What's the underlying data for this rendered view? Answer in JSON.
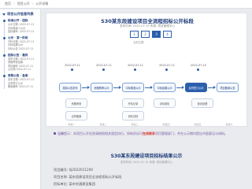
{
  "breadcrumb": [
    "首页",
    "项目公开",
    "公开详情"
  ],
  "sidebar": {
    "heading": "项目公开信息列表",
    "items": [
      {
        "title": "标准公开 · 招标",
        "lines": [
          "公示日期: 2022-07-11",
          "中标候选人公示",
          "招标编号: 2022-07-11"
        ]
      },
      {
        "title": "公示 · 第一阶段",
        "lines": [
          "开标日期: 2022-07-11",
          "评标结果公示",
          "中标公告 2022-07-11"
        ]
      },
      {
        "title": "招标公告 · 最终",
        "lines": [
          "发布日期: 2022-07-11",
          "资格审查结果",
          "项目编号 2022-07-11",
          "公示期 2022-07-11"
        ]
      },
      {
        "title": "采购公告 · 备案",
        "lines": [
          "发布日期: 2022-07-11",
          "合同签订公示",
          "备案编号 2022-07-11"
        ]
      }
    ]
  },
  "main": {
    "title": "S30某东段建设项目全流程招标公开标段",
    "subline": "发布时间: 2022-07-19  来源: 项目管理中心",
    "tabs": [
      "1",
      "2",
      "3",
      "4"
    ],
    "active_tab": 2,
    "jump": "当前位置",
    "dates": [
      "2022-07-11",
      "2022-07-11",
      "2022-07-11",
      "2022-07-11",
      "2022-07-15"
    ],
    "nodes_row1": [
      "招标公告发布",
      "资格预审公示",
      "中标候选公示",
      "中标结果公示",
      "合同签订公示",
      "项目备案公告"
    ],
    "nodes_row2": [
      "资格审查",
      "开标记录",
      "评标报告",
      "投诉处理"
    ],
    "nodes_row3": [
      "合同备案",
      "资料归档"
    ],
    "stages": [
      "标段一",
      "标段二",
      "标段三",
      "标段四",
      "标段五",
      "标段六"
    ]
  },
  "notice": {
    "before": "温馨提示：本项目公开信息请按照相关规定执行，如有异议可",
    "red": "在线联系",
    "after": "项目管理部门，并在公示期内提出书面意见与材料。"
  },
  "document": {
    "title": "S30某东段建设项目招标结果公示",
    "date": "发布时间: 2022-07-19  来源: 项目管理中心",
    "lines": [
      "项目编号: SJ2022011200",
      "项目名称: 某东段建设项目全流程招标公开标段",
      "招标单位: 某市交通建设集团"
    ]
  }
}
